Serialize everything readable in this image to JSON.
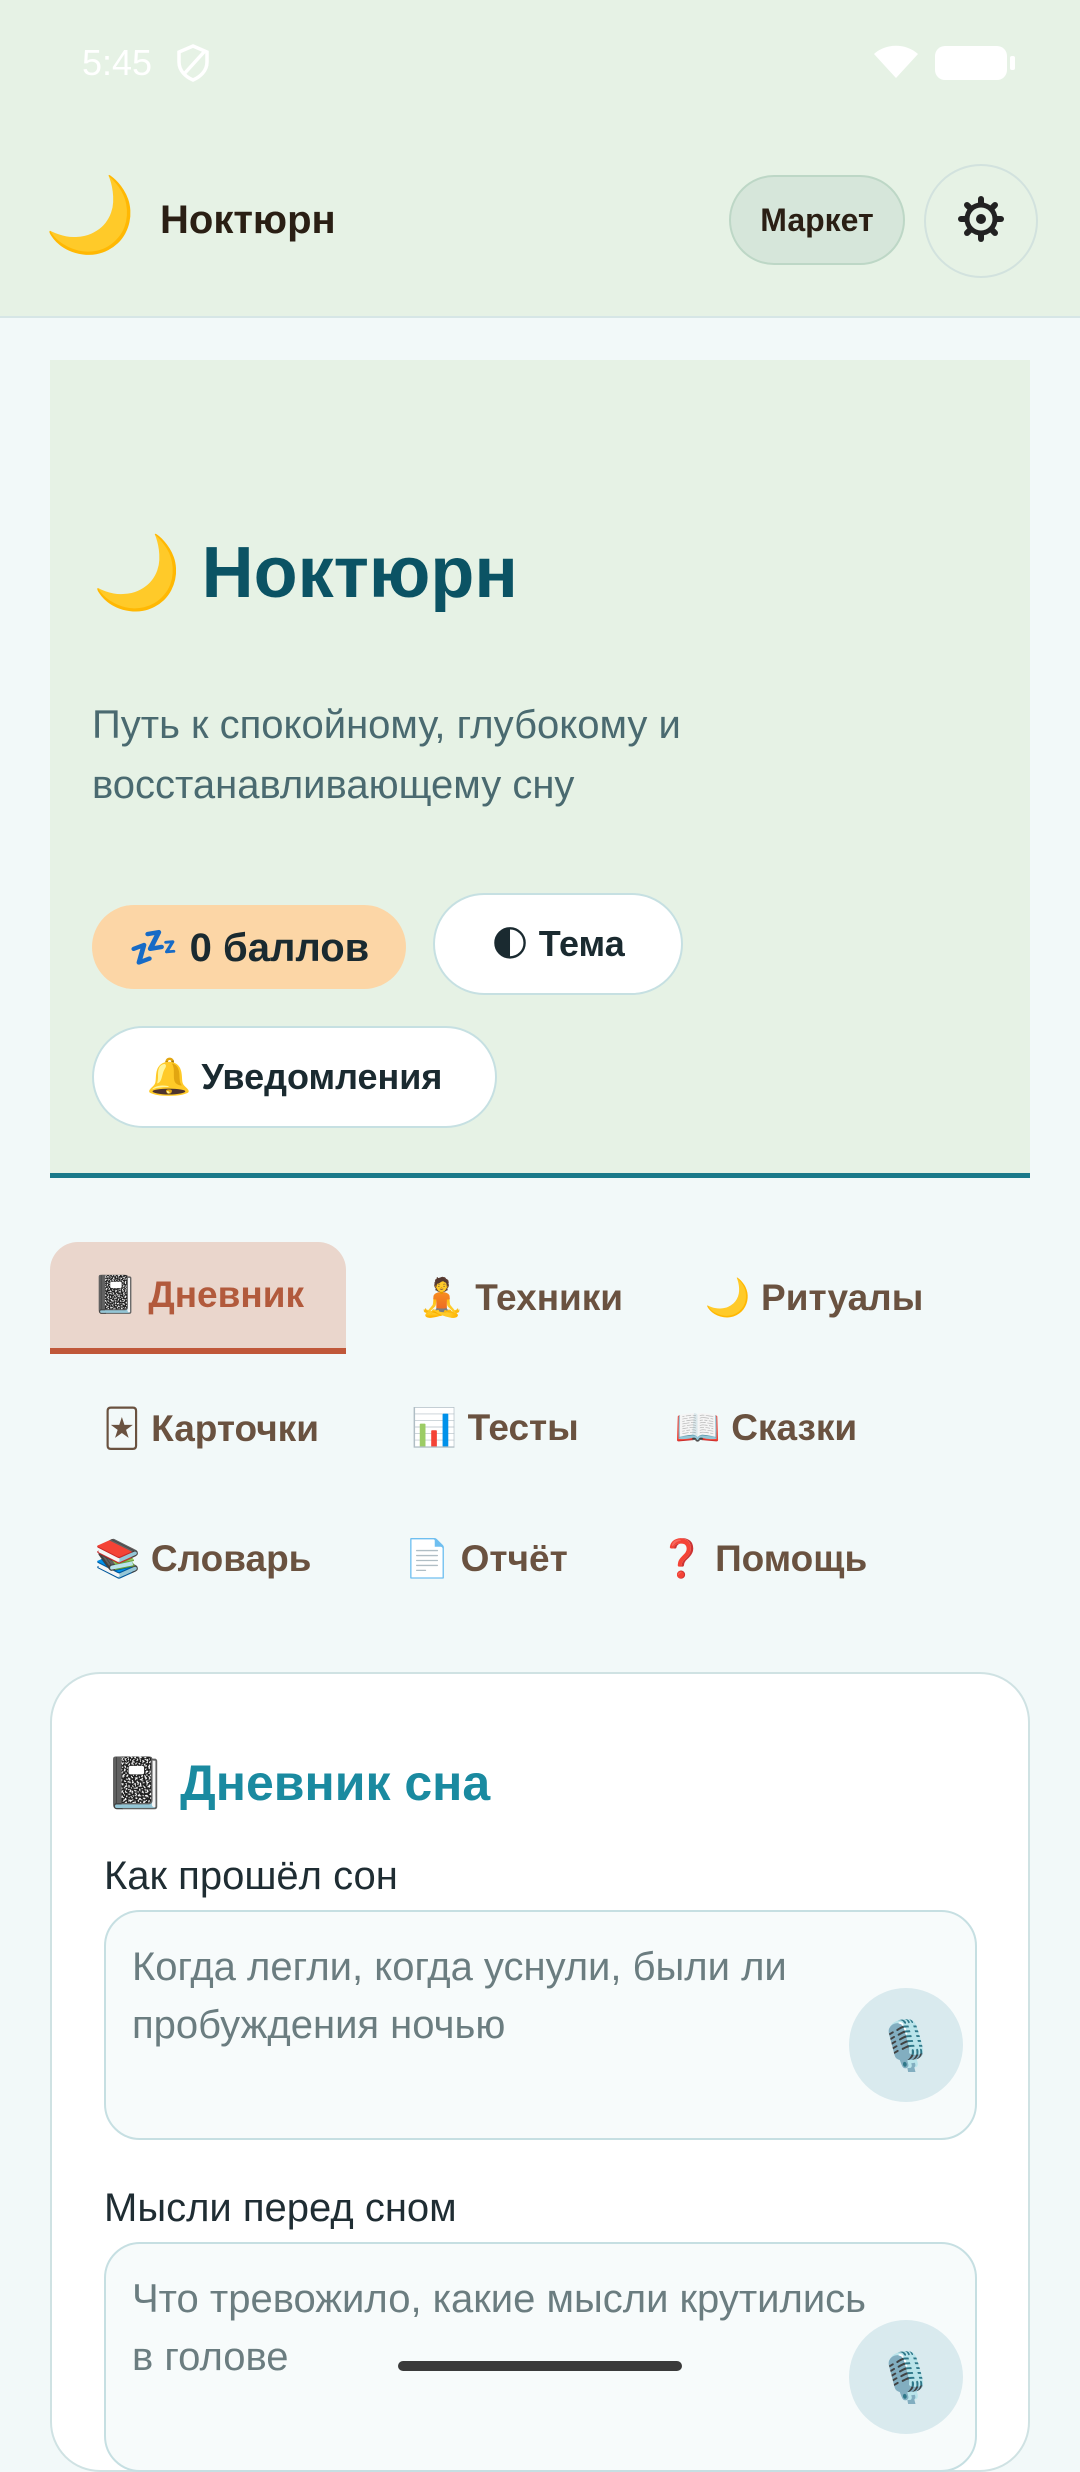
{
  "status": {
    "time": "5:45"
  },
  "appbar": {
    "title": "Ноктюрн",
    "market_label": "Маркет",
    "moon_icon": "🌙"
  },
  "hero": {
    "title": "🌙 Ноктюрн",
    "subtitle": "Путь к спокойному, глубокому и восстанавливающему сну",
    "points_label": "💤 0 баллов",
    "theme_label": "🌓 Тема",
    "notifications_label": "🔔 Уведомления"
  },
  "tabs": [
    {
      "label": "📓 Дневник",
      "active": true
    },
    {
      "label": "🧘 Техники",
      "active": false
    },
    {
      "label": "🌙 Ритуалы",
      "active": false
    },
    {
      "label": "🃏 Карточки",
      "active": false
    },
    {
      "label": "📊 Тесты",
      "active": false
    },
    {
      "label": "📖 Сказки",
      "active": false
    },
    {
      "label": "📚 Словарь",
      "active": false
    },
    {
      "label": "📄 Отчёт",
      "active": false
    },
    {
      "label": "❓ Помощь",
      "active": false
    }
  ],
  "diary": {
    "title": "📓 Дневник сна",
    "sleep_label": "Как прошёл сон",
    "sleep_placeholder": "Когда легли, когда уснули, были ли пробуждения ночью",
    "thoughts_label": "Мысли перед сном",
    "thoughts_placeholder": "Что тревожило, какие мысли крутились в голове",
    "mic_icon": "🎙️"
  },
  "colors": {
    "accent": "#1a8aa0",
    "active_tab": "#c0583a",
    "hero_bg": "#e6f2e5"
  }
}
